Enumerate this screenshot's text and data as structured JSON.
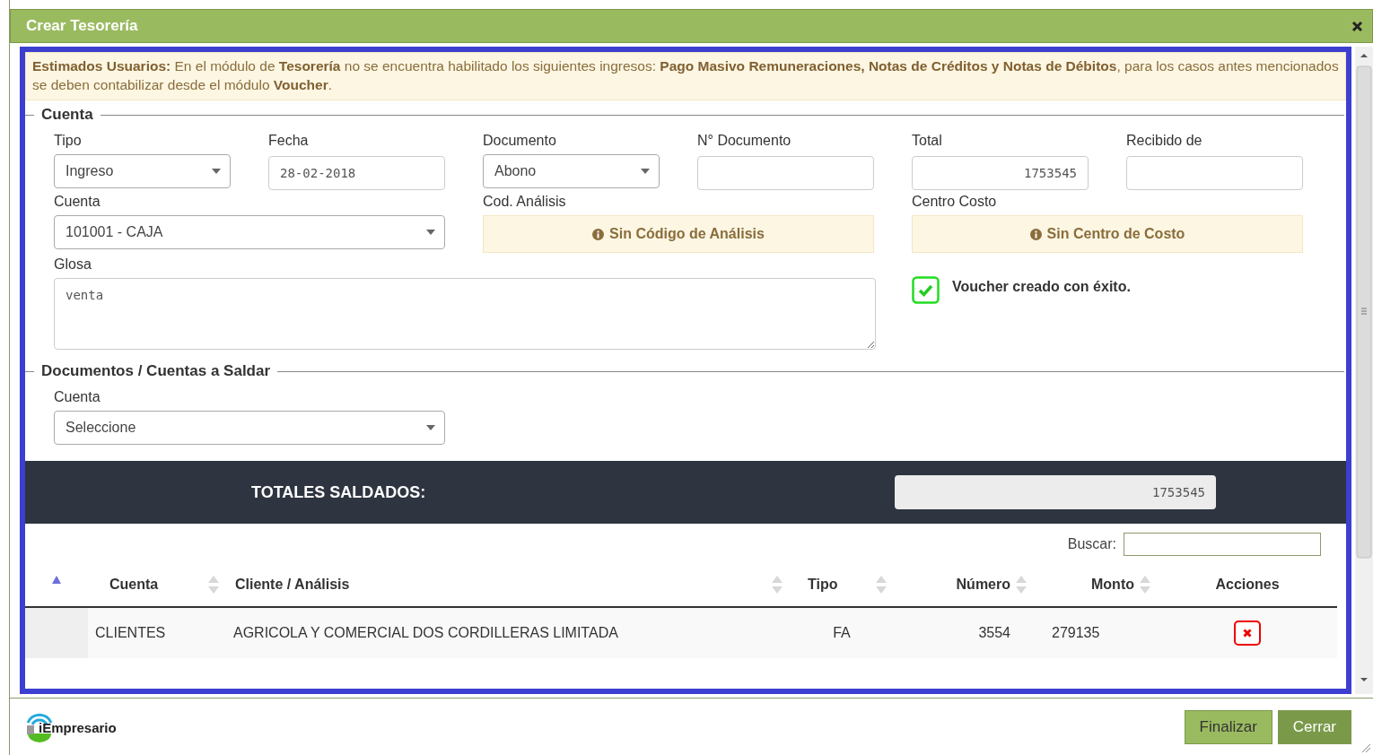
{
  "window": {
    "title": "Crear Tesorería"
  },
  "notice": "**Estimados Usuarios:** En el módulo de **Tesorería** no se encuentra habilitado los siguientes ingresos: **Pago Masivo Remuneraciones, Notas de Créditos y Notas de Débitos**, para los casos antes mencionados se deben contabilizar desde el módulo **Voucher**.",
  "cuenta_section": {
    "legend": "Cuenta",
    "fields": [
      {
        "label": "Tipo",
        "kind": "select",
        "value": "Ingreso"
      },
      {
        "label": "Fecha",
        "kind": "input",
        "value": "28-02-2018"
      },
      {
        "label": "Documento",
        "kind": "select",
        "value": "Abono"
      },
      {
        "label": "N° Documento",
        "kind": "input"
      },
      {
        "label": "Total",
        "kind": "number",
        "value": "1753545"
      },
      {
        "label": "Recibido de",
        "kind": "input"
      }
    ],
    "cuenta": {
      "label": "Cuenta",
      "value": "101001 - CAJA"
    },
    "cod_analisis": {
      "label": "Cod. Análisis",
      "text": "Sin Código de Análisis"
    },
    "centro_costo": {
      "label": "Centro Costo",
      "text": "Sin Centro de Costo"
    },
    "glosa": {
      "label": "Glosa",
      "value": "venta"
    },
    "status": {
      "checked": true,
      "text": "Voucher creado con éxito."
    }
  },
  "documentos_section": {
    "legend": "Documentos / Cuentas a Saldar",
    "cuenta": {
      "label": "Cuenta",
      "value": "Seleccione"
    }
  },
  "totals": {
    "label": "TOTALES SALDADOS:",
    "value": "1753545"
  },
  "search": {
    "label": "Buscar:"
  },
  "table": {
    "columns": [
      {
        "sorted": true
      },
      {
        "label": "Cuenta",
        "sorted": false
      },
      {
        "label": "Cliente / Análisis",
        "sorted": false
      },
      {
        "label": "Tipo",
        "sorted": false
      },
      {
        "label": "Número",
        "sorted": false
      },
      {
        "label": "Monto",
        "sorted": false
      },
      {
        "label": "Acciones"
      }
    ],
    "rows": [
      {
        "cuenta": "CLIENTES",
        "cliente": "AGRICOLA Y COMERCIAL DOS CORDILLERAS LIMITADA",
        "tipo": "FA",
        "numero": "3554",
        "monto": "279135"
      }
    ]
  },
  "footer": {
    "logo": "iEmpresario",
    "buttons": [
      "Finalizar",
      "Cerrar"
    ]
  }
}
